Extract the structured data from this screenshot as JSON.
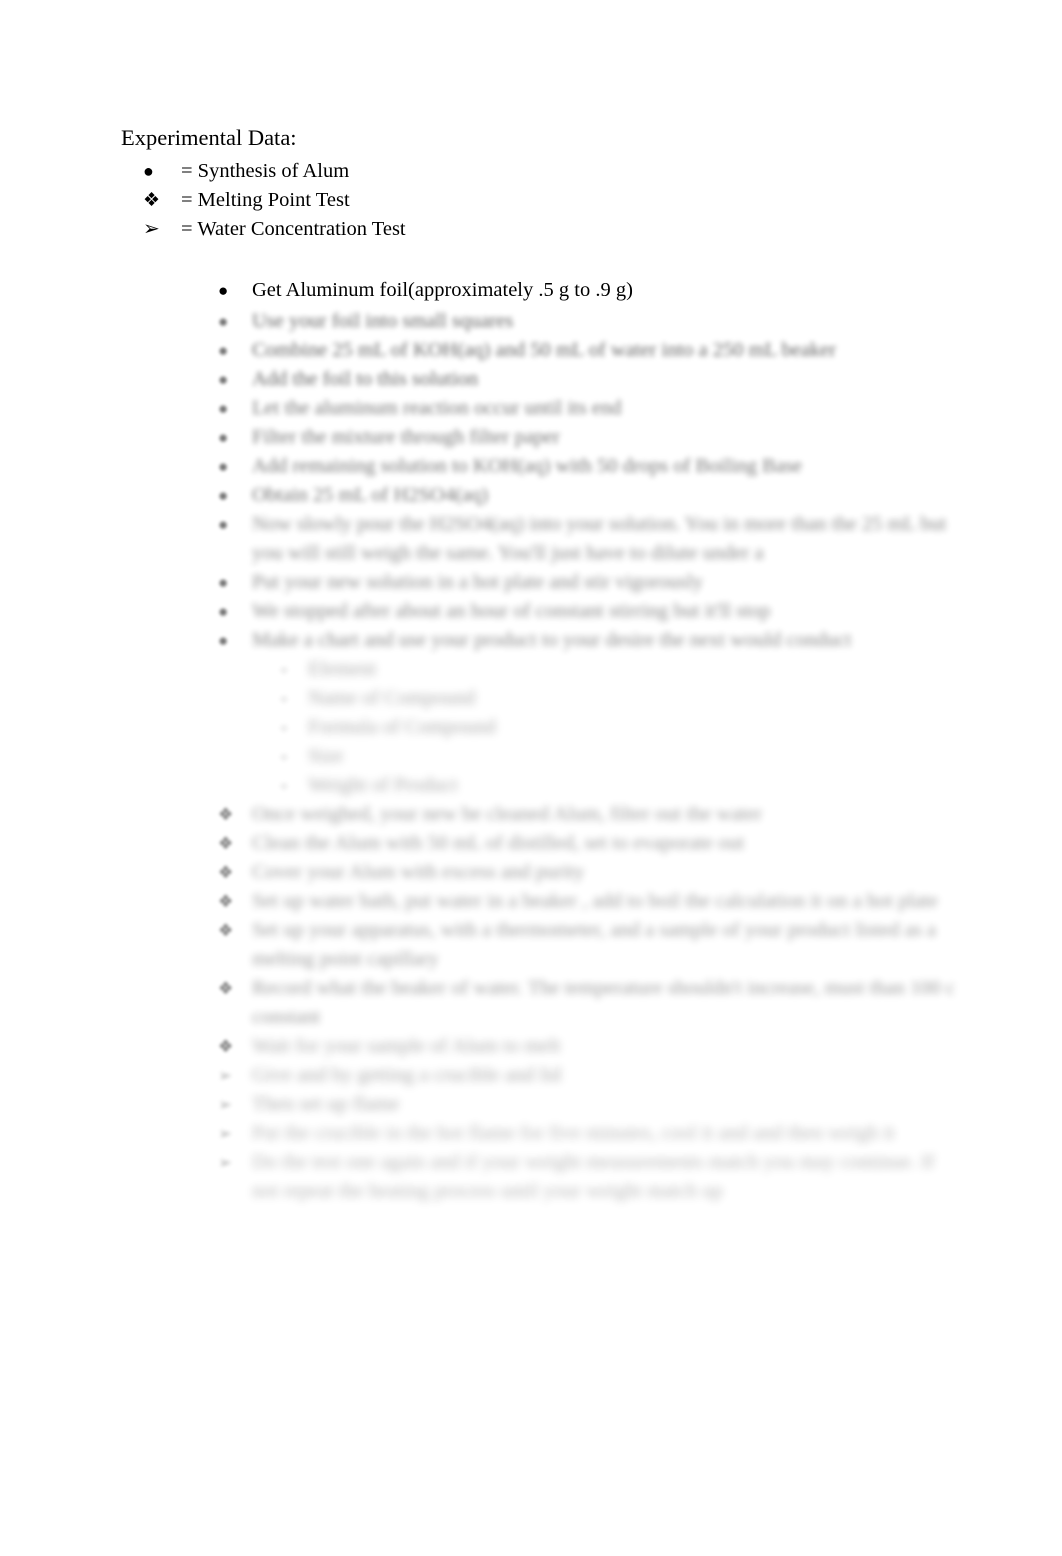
{
  "document": {
    "heading": "Experimental Data:",
    "background_color": "#ffffff",
    "text_color": "#000000"
  },
  "legend": {
    "items": [
      {
        "marker": "●",
        "marker_name": "filled-circle-bullet",
        "label": "= Synthesis of Alum"
      },
      {
        "marker": "❖",
        "marker_name": "diamond-cluster-bullet",
        "label": "= Melting Point Test"
      },
      {
        "marker": "➢",
        "marker_name": "arrowhead-bullet",
        "label": "= Water Concentration Test"
      }
    ]
  },
  "procedure": {
    "items": [
      {
        "marker": "●",
        "text": "Get Aluminum foil(approximately .5 g to .9 g)",
        "legible": true,
        "blur": 0
      },
      {
        "marker": "●",
        "text": "",
        "legible": false,
        "blur": 1
      },
      {
        "marker": "●",
        "text": "",
        "legible": false,
        "blur": 1
      },
      {
        "marker": "●",
        "text": "",
        "legible": false,
        "blur": 1
      },
      {
        "marker": "●",
        "text": "",
        "legible": false,
        "blur": 2
      },
      {
        "marker": "●",
        "text": "",
        "legible": false,
        "blur": 2
      },
      {
        "marker": "●",
        "text": "",
        "legible": false,
        "blur": 2
      },
      {
        "marker": "●",
        "text": "",
        "legible": false,
        "blur": 2
      },
      {
        "marker": "●",
        "text": "",
        "legible": false,
        "blur": 3
      },
      {
        "marker": "●",
        "text": "",
        "legible": false,
        "blur": 3
      },
      {
        "marker": "●",
        "text": "",
        "legible": false,
        "blur": 3
      },
      {
        "marker": "●",
        "text": "",
        "legible": false,
        "blur": 3
      }
    ],
    "nested_items": [
      {
        "marker": "○",
        "text": "",
        "legible": false,
        "blur": 5
      },
      {
        "marker": "○",
        "text": "",
        "legible": false,
        "blur": 5
      },
      {
        "marker": "○",
        "text": "",
        "legible": false,
        "blur": 5
      },
      {
        "marker": "○",
        "text": "",
        "legible": false,
        "blur": 5
      },
      {
        "marker": "○",
        "text": "",
        "legible": false,
        "blur": 5
      }
    ],
    "melting_point_items": [
      {
        "marker": "❖",
        "text": "",
        "legible": false,
        "blur": 4
      },
      {
        "marker": "❖",
        "text": "",
        "legible": false,
        "blur": 4
      },
      {
        "marker": "❖",
        "text": "",
        "legible": false,
        "blur": 4
      },
      {
        "marker": "❖",
        "text": "",
        "legible": false,
        "blur": 4
      },
      {
        "marker": "❖",
        "text": "",
        "legible": false,
        "blur": 4
      },
      {
        "marker": "❖",
        "text": "",
        "legible": false,
        "blur": 4
      },
      {
        "marker": "❖",
        "text": "",
        "legible": false,
        "blur": 5
      }
    ],
    "water_concentration_items": [
      {
        "marker": "➢",
        "text": "",
        "legible": false,
        "blur": 5
      },
      {
        "marker": "➢",
        "text": "",
        "legible": false,
        "blur": 5
      },
      {
        "marker": "➢",
        "text": "",
        "legible": false,
        "blur": 6
      },
      {
        "marker": "➢",
        "text": "",
        "legible": false,
        "blur": 6
      }
    ]
  }
}
